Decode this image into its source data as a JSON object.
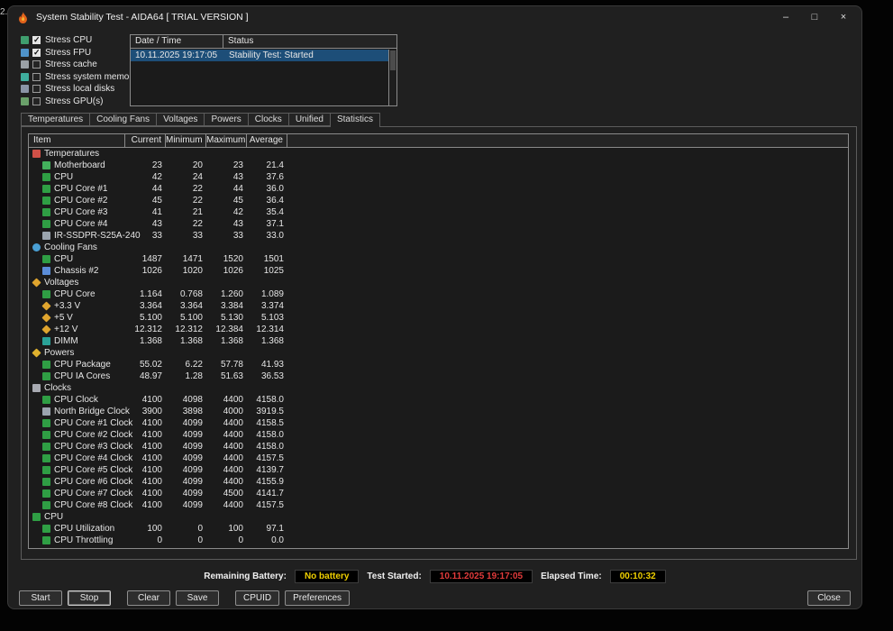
{
  "desktop_artifact": "2.",
  "window": {
    "title": "System Stability Test - AIDA64  [ TRIAL VERSION ]",
    "minimize_glyph": "–",
    "maximize_glyph": "□",
    "close_glyph": "×"
  },
  "stress_options": [
    {
      "label": "Stress CPU",
      "checked": true,
      "icon": "cpu-stress-icon",
      "color": "#3f9e6e"
    },
    {
      "label": "Stress FPU",
      "checked": true,
      "icon": "fpu-stress-icon",
      "color": "#4f93c9"
    },
    {
      "label": "Stress cache",
      "checked": false,
      "icon": "cache-stress-icon",
      "color": "#9aa0a6"
    },
    {
      "label": "Stress system memory",
      "checked": false,
      "icon": "memory-stress-icon",
      "color": "#3fae9e"
    },
    {
      "label": "Stress local disks",
      "checked": false,
      "icon": "disk-stress-icon",
      "color": "#8a94a6"
    },
    {
      "label": "Stress GPU(s)",
      "checked": false,
      "icon": "gpu-stress-icon",
      "color": "#6aa06a"
    }
  ],
  "log": {
    "columns": [
      "Date / Time",
      "Status"
    ],
    "rows": [
      {
        "datetime": "10.11.2025 19:17:05",
        "status": "Stability Test: Started",
        "selected": true
      }
    ]
  },
  "tabs": [
    {
      "label": "Temperatures"
    },
    {
      "label": "Cooling Fans"
    },
    {
      "label": "Voltages"
    },
    {
      "label": "Powers"
    },
    {
      "label": "Clocks"
    },
    {
      "label": "Unified"
    },
    {
      "label": "Statistics",
      "active": true
    }
  ],
  "stats": {
    "columns": [
      "Item",
      "Current",
      "Minimum",
      "Maximum",
      "Average"
    ],
    "rows": [
      {
        "kind": "group",
        "label": "Temperatures",
        "icon": "temperature-icon",
        "color": "#cf5047"
      },
      {
        "kind": "item",
        "label": "Motherboard",
        "icon": "motherboard-icon",
        "color": "#43b05c",
        "current": 23,
        "min": 20,
        "max": 23,
        "avg": "21.4"
      },
      {
        "kind": "item",
        "label": "CPU",
        "icon": "cpu-icon",
        "color": "#2f9e44",
        "current": 42,
        "min": 24,
        "max": 43,
        "avg": "37.6"
      },
      {
        "kind": "item",
        "label": "CPU Core #1",
        "icon": "cpu-core-icon",
        "color": "#2f9e44",
        "current": 44,
        "min": 22,
        "max": 44,
        "avg": "36.0"
      },
      {
        "kind": "item",
        "label": "CPU Core #2",
        "icon": "cpu-core-icon",
        "color": "#2f9e44",
        "current": 45,
        "min": 22,
        "max": 45,
        "avg": "36.4"
      },
      {
        "kind": "item",
        "label": "CPU Core #3",
        "icon": "cpu-core-icon",
        "color": "#2f9e44",
        "current": 41,
        "min": 21,
        "max": 42,
        "avg": "35.4"
      },
      {
        "kind": "item",
        "label": "CPU Core #4",
        "icon": "cpu-core-icon",
        "color": "#2f9e44",
        "current": 43,
        "min": 22,
        "max": 43,
        "avg": "37.1"
      },
      {
        "kind": "item",
        "label": "IR-SSDPR-S25A-240",
        "icon": "ssd-icon",
        "color": "#9aa4ae",
        "current": 33,
        "min": 33,
        "max": 33,
        "avg": "33.0"
      },
      {
        "kind": "group",
        "label": "Cooling Fans",
        "icon": "fan-icon",
        "color": "#4a9fd4",
        "shape": "circle"
      },
      {
        "kind": "item",
        "label": "CPU",
        "icon": "cpu-fan-icon",
        "color": "#2f9e44",
        "current": 1487,
        "min": 1471,
        "max": 1520,
        "avg": 1501
      },
      {
        "kind": "item",
        "label": "Chassis #2",
        "icon": "chassis-fan-icon",
        "color": "#5b8dd9",
        "current": 1026,
        "min": 1020,
        "max": 1026,
        "avg": 1025
      },
      {
        "kind": "group",
        "label": "Voltages",
        "icon": "voltage-icon",
        "color": "#e0a52e",
        "shape": "diamond"
      },
      {
        "kind": "item",
        "label": "CPU Core",
        "icon": "cpu-core-voltage-icon",
        "color": "#2f9e44",
        "current": "1.164",
        "min": "0.768",
        "max": "1.260",
        "avg": "1.089"
      },
      {
        "kind": "item",
        "label": "+3.3 V",
        "icon": "voltage-rail-icon",
        "color": "#e0a52e",
        "shape": "diamond",
        "current": "3.364",
        "min": "3.364",
        "max": "3.384",
        "avg": "3.374"
      },
      {
        "kind": "item",
        "label": "+5 V",
        "icon": "voltage-rail-icon",
        "color": "#e0a52e",
        "shape": "diamond",
        "current": "5.100",
        "min": "5.100",
        "max": "5.130",
        "avg": "5.103"
      },
      {
        "kind": "item",
        "label": "+12 V",
        "icon": "voltage-rail-icon",
        "color": "#e0a52e",
        "shape": "diamond",
        "current": "12.312",
        "min": "12.312",
        "max": "12.384",
        "avg": "12.314"
      },
      {
        "kind": "item",
        "label": "DIMM",
        "icon": "dimm-icon",
        "color": "#2aa198",
        "current": "1.368",
        "min": "1.368",
        "max": "1.368",
        "avg": "1.368"
      },
      {
        "kind": "group",
        "label": "Powers",
        "icon": "power-icon",
        "color": "#e0b22e",
        "shape": "diamond"
      },
      {
        "kind": "item",
        "label": "CPU Package",
        "icon": "cpu-package-icon",
        "color": "#2f9e44",
        "current": "55.02",
        "min": "6.22",
        "max": "57.78",
        "avg": "41.93"
      },
      {
        "kind": "item",
        "label": "CPU IA Cores",
        "icon": "cpu-ia-cores-icon",
        "color": "#2f9e44",
        "current": "48.97",
        "min": "1.28",
        "max": "51.63",
        "avg": "36.53"
      },
      {
        "kind": "group",
        "label": "Clocks",
        "icon": "clock-icon",
        "color": "#a8aab2"
      },
      {
        "kind": "item",
        "label": "CPU Clock",
        "icon": "cpu-clock-icon",
        "color": "#2f9e44",
        "current": 4100,
        "min": 4098,
        "max": 4400,
        "avg": "4158.0"
      },
      {
        "kind": "item",
        "label": "North Bridge Clock",
        "icon": "north-bridge-clock-icon",
        "color": "#9aa4ae",
        "current": 3900,
        "min": 3898,
        "max": 4000,
        "avg": "3919.5"
      },
      {
        "kind": "item",
        "label": "CPU Core #1 Clock",
        "icon": "cpu-core-clock-icon",
        "color": "#2f9e44",
        "current": 4100,
        "min": 4099,
        "max": 4400,
        "avg": "4158.5"
      },
      {
        "kind": "item",
        "label": "CPU Core #2 Clock",
        "icon": "cpu-core-clock-icon",
        "color": "#2f9e44",
        "current": 4100,
        "min": 4099,
        "max": 4400,
        "avg": "4158.0"
      },
      {
        "kind": "item",
        "label": "CPU Core #3 Clock",
        "icon": "cpu-core-clock-icon",
        "color": "#2f9e44",
        "current": 4100,
        "min": 4099,
        "max": 4400,
        "avg": "4158.0"
      },
      {
        "kind": "item",
        "label": "CPU Core #4 Clock",
        "icon": "cpu-core-clock-icon",
        "color": "#2f9e44",
        "current": 4100,
        "min": 4099,
        "max": 4400,
        "avg": "4157.5"
      },
      {
        "kind": "item",
        "label": "CPU Core #5 Clock",
        "icon": "cpu-core-clock-icon",
        "color": "#2f9e44",
        "current": 4100,
        "min": 4099,
        "max": 4400,
        "avg": "4139.7"
      },
      {
        "kind": "item",
        "label": "CPU Core #6 Clock",
        "icon": "cpu-core-clock-icon",
        "color": "#2f9e44",
        "current": 4100,
        "min": 4099,
        "max": 4400,
        "avg": "4155.9"
      },
      {
        "kind": "item",
        "label": "CPU Core #7 Clock",
        "icon": "cpu-core-clock-icon",
        "color": "#2f9e44",
        "current": 4100,
        "min": 4099,
        "max": 4500,
        "avg": "4141.7"
      },
      {
        "kind": "item",
        "label": "CPU Core #8 Clock",
        "icon": "cpu-core-clock-icon",
        "color": "#2f9e44",
        "current": 4100,
        "min": 4099,
        "max": 4400,
        "avg": "4157.5"
      },
      {
        "kind": "group",
        "label": "CPU",
        "icon": "cpu-group-icon",
        "color": "#2f9e44"
      },
      {
        "kind": "item",
        "label": "CPU Utilization",
        "icon": "cpu-utilization-icon",
        "color": "#2f9e44",
        "current": 100,
        "min": 0,
        "max": 100,
        "avg": "97.1"
      },
      {
        "kind": "item",
        "label": "CPU Throttling",
        "icon": "cpu-throttling-icon",
        "color": "#2f9e44",
        "current": 0,
        "min": 0,
        "max": 0,
        "avg": "0.0"
      }
    ]
  },
  "status_bar": {
    "remaining_battery_label": "Remaining Battery:",
    "remaining_battery_value": "No battery",
    "battery_color": "#f0d000",
    "test_started_label": "Test Started:",
    "test_started_value": "10.11.2025 19:17:05",
    "started_color": "#e23b3b",
    "elapsed_label": "Elapsed Time:",
    "elapsed_value": "00:10:32",
    "elapsed_color": "#f0d000"
  },
  "buttons": {
    "start": "Start",
    "stop": "Stop",
    "clear": "Clear",
    "save": "Save",
    "cpuid": "CPUID",
    "preferences": "Preferences",
    "close": "Close"
  }
}
